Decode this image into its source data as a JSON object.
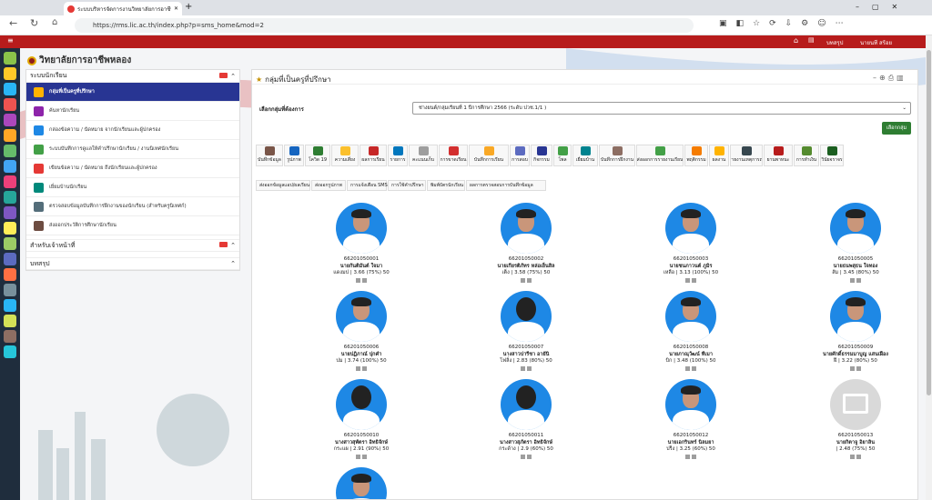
{
  "browser": {
    "tab_title": "ระบบบริหารจัดการงานวิทยาลัยการอาชีพ",
    "url": "https://rms.lic.ac.th/index.php?p=sms_home&mod=2"
  },
  "topbar": {
    "user1": "บทสรุป",
    "user2": "นายนที สร้อย"
  },
  "site": {
    "name": "วิทยาลัยการอาชีพหลอง"
  },
  "left": {
    "section1": "ระบบนักเรียน",
    "items": [
      "กลุ่มที่เป็นครูที่ปรึกษา",
      "ค้นหานักเรียน",
      "กล่องข้อความ / นัดหมาย จากนักเรียนและผู้ปกครอง",
      "ระบบบันทึกการดูแลให้คำปรึกษานักเรียน / งานนิเทศนักเรียน",
      "เขียนข้อความ / นัดหมาย ถึงนักเรียนและผู้ปกครอง",
      "เยี่ยมบ้านนักเรียน",
      "ตรวจสอบข้อมูลบันทึกการฝึกงานของนักเรียน (สำหรับครูนิเทศก์)",
      "ส่งออกประวัติการศึกษานักเรียน"
    ],
    "section2": "สำหรับเจ้าหน้าที่",
    "section3": "บทสรุป"
  },
  "main": {
    "title": "กลุ่มที่เป็นครูที่ปรึกษา",
    "select_label": "เลือกกลุ่มที่ต้องการ",
    "select_value": "ช่างยนต์/กลุ่มเรียนที่ 1 ปีการศึกษา 2566 (ระดับ ปวช.1/1 )",
    "ok": "เลือกกลุ่ม",
    "tools1": [
      "บันทึกข้อมูล",
      "รูปภาพ",
      "โควิด 19",
      "ความเสี่ยง",
      "ผลการเรียน",
      "รายการ",
      "คะแนนเก็บ",
      "การขาดเรียน",
      "บันทึกการเรียน",
      "การสอบ",
      "กิจกรรม",
      "โพล",
      "เยี่ยมบ้าน",
      "บันทึกการฝึกงาน",
      "ส่งออกการรายงานเรียน",
      "พฤติกรรม",
      "ผลงาน",
      "รายงานเหตุการณ์",
      "ยานพาหนะ",
      "การทำเงิน",
      "วินัยจราจร"
    ],
    "tools2": [
      "ส่งออกข้อมูลแอป/ผลเรียน",
      "ส่งออกรูปภาพ",
      "การแจ้งเตือน SMS",
      "การใช้คำปรึกษา",
      "พิมพ์บัตรนักเรียน",
      "ผลการตรวจสอบการบันทึกข้อมูล"
    ]
  },
  "students": [
    {
      "id": "66201050001",
      "name": "นายกันติมันต์ ใจมา",
      "meta": "แดงมป | 3.66 (75%) 50",
      "gender": "m"
    },
    {
      "id": "66201050002",
      "name": "นายเกียรติภัทร หล่อเย็นสิล",
      "meta": "เต็ง | 3.58 (75%) 50",
      "gender": "m"
    },
    {
      "id": "66201050003",
      "name": "นายชนภาวนต์ ภูมิร",
      "meta": "เหลือ | 3.13 (100%) 50",
      "gender": "m"
    },
    {
      "id": "66201050005",
      "name": "นายธนพสุธน ใจทอง",
      "meta": "ส้ม | 3.45 (80%) 50",
      "gender": "m"
    },
    {
      "id": "66201050006",
      "name": "นายปฏิภาณ์ ปุกคำ",
      "meta": "ปม | 3.74 (100%) 50",
      "gender": "m"
    },
    {
      "id": "66201050007",
      "name": "นางสาวปารีชา อายันิ",
      "meta": "โฟลิ่ง | 2.83 (80%) 50",
      "gender": "f"
    },
    {
      "id": "66201050008",
      "name": "นายภาณุวัฒน์ ทีเมา",
      "meta": "บิก | 3.48 (100%) 50",
      "gender": "m"
    },
    {
      "id": "66201050009",
      "name": "นายศักดิ์ธรรมมาบูญ แสนเฝือง",
      "meta": "ฝึ | 3.22 (80%) 50",
      "gender": "m"
    },
    {
      "id": "66201050010",
      "name": "นางสาวสุพัตรา อิทธิจักษ์",
      "meta": "กระแผ | 2.91 (90%) 50",
      "gender": "f"
    },
    {
      "id": "66201050011",
      "name": "นางสาวสุภัตรา อิทธิจักษ์",
      "meta": "กระด้าง | 2.9 (60%) 50",
      "gender": "f"
    },
    {
      "id": "66201050012",
      "name": "นายเอกรินทร์ นิลมยา",
      "meta": "ปร็ง | 3.25 (60%) 50",
      "gender": "m"
    },
    {
      "id": "66201050013",
      "name": "นายกิตาจู อิยาลิน",
      "meta": "| 2.48 (75%) 50",
      "gender": "none"
    },
    {
      "id": "",
      "name": "",
      "meta": "",
      "gender": "m"
    }
  ]
}
